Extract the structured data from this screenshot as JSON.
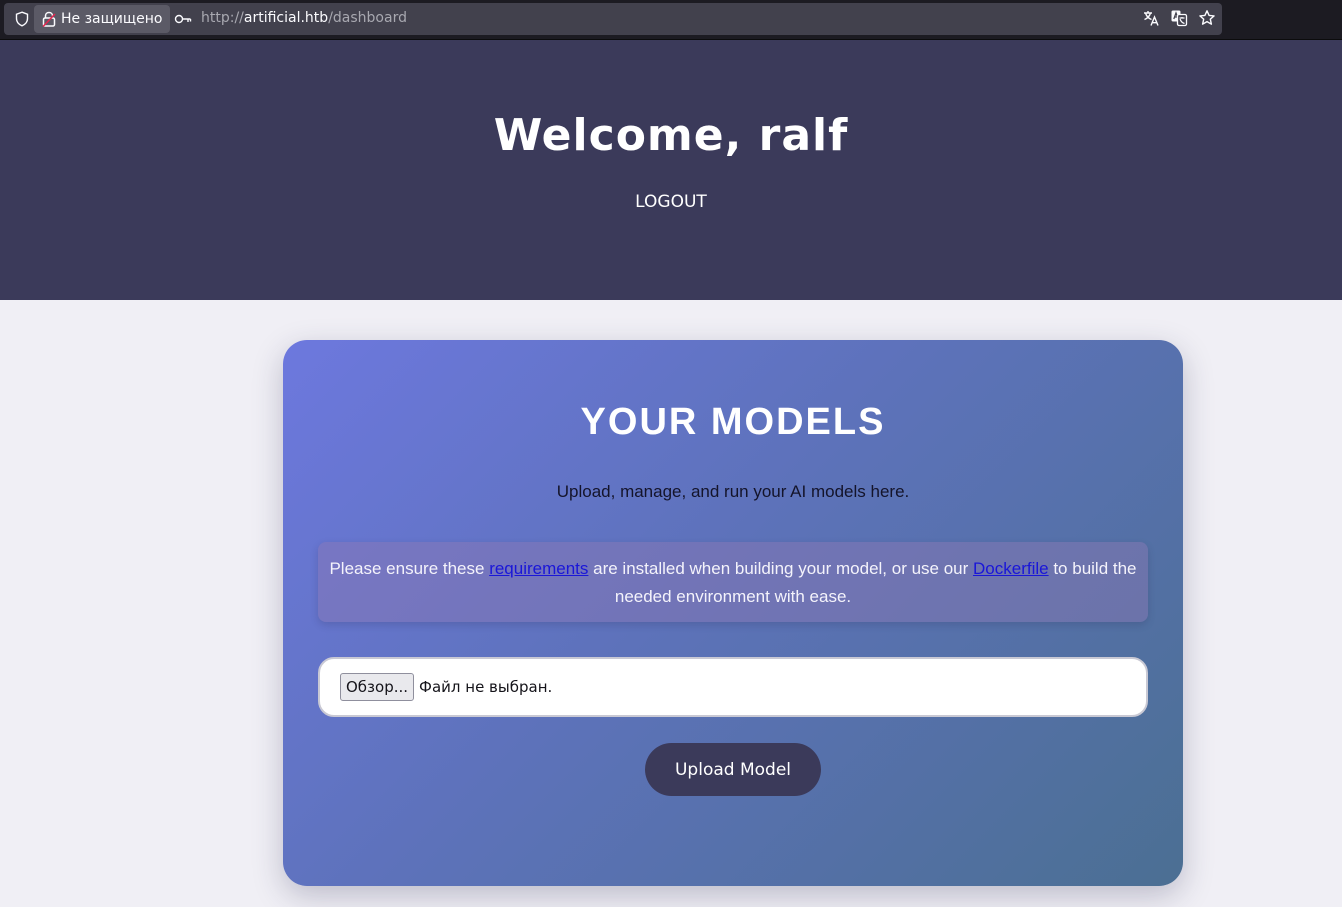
{
  "browser": {
    "security_label": "Не защищено",
    "url_scheme": "http://",
    "url_host": "artificial.htb",
    "url_path": "/dashboard"
  },
  "header": {
    "welcome": "Welcome, ralf",
    "logout_label": "LOGOUT"
  },
  "card": {
    "title": "YOUR MODELS",
    "subtitle": "Upload, manage, and run your AI models here.",
    "notice": {
      "text_1": "Please ensure these ",
      "requirements_link": "requirements",
      "text_2": " are installed when building your model, or use our ",
      "dockerfile_link": "Dockerfile",
      "text_3": " to build the needed environment with ease."
    },
    "file_input": {
      "browse_label": "Обзор...",
      "status": "Файл не выбран."
    },
    "upload_label": "Upload Model"
  },
  "colors": {
    "header_bg": "#3b3a5a",
    "page_bg": "#f0eff5",
    "card_gradient_start": "#6d78de",
    "card_gradient_end": "#4b6f93",
    "link": "#1a16d8"
  },
  "icons": [
    "shield-icon",
    "lock-warning-icon",
    "key-icon",
    "translate-icon",
    "translate-page-icon",
    "bookmark-star-icon"
  ]
}
